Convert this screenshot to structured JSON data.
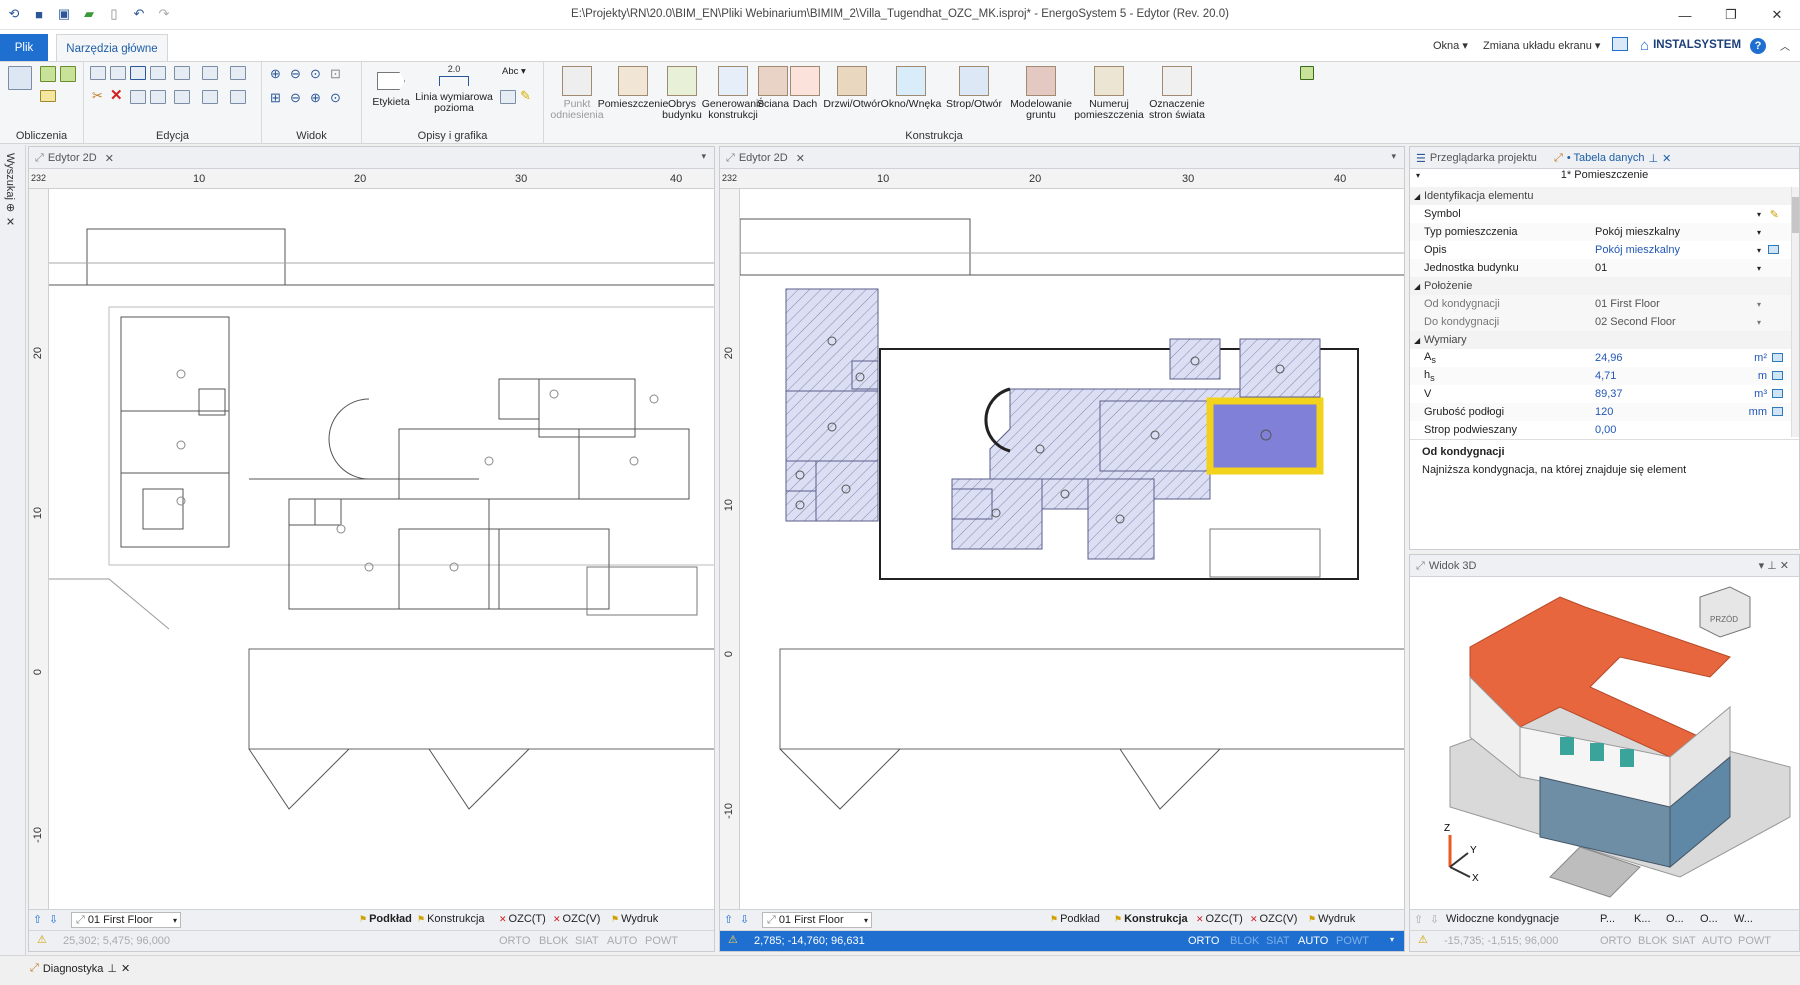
{
  "window": {
    "title": "E:\\Projekty\\RN\\20.0\\BIM_EN\\Pliki Webinarium\\BIMIM_2\\Villa_Tugendhat_OZC_MK.isproj* - EnergoSystem 5 - Edytor (Rev. 20.0)"
  },
  "tabs": {
    "file": "Plik",
    "main": "Narzędzia główne"
  },
  "topright": {
    "windows": "Okna",
    "layout": "Zmiana układu ekranu",
    "brand": "INSTALSYSTEM",
    "help": "?"
  },
  "ribbon": {
    "groups": {
      "calc": "Obliczenia",
      "edit": "Edycja",
      "view": "Widok",
      "desc": "Opisy i grafika",
      "constr": "Konstrukcja"
    },
    "desc_buttons": {
      "label": "Etykieta",
      "dimline": "Linia wymiarowa\npozioma",
      "dim_value": "2.0",
      "abc": "Abc"
    },
    "constr_buttons": [
      {
        "label": "Punkt\nodniesienia",
        "icon": "reference-point-icon",
        "disabled": true
      },
      {
        "label": "Pomieszczenie",
        "icon": "room-icon",
        "disabled": false
      },
      {
        "label": "Obrys\nbudynku",
        "icon": "building-outline-icon",
        "disabled": false
      },
      {
        "label": "Generowanie\nkonstrukcji",
        "icon": "generate-construction-icon",
        "disabled": false
      },
      {
        "label": "Ściana",
        "icon": "wall-icon",
        "disabled": false
      },
      {
        "label": "Dach",
        "icon": "roof-icon",
        "disabled": false
      },
      {
        "label": "Drzwi/Otwór",
        "icon": "door-icon",
        "disabled": false
      },
      {
        "label": "Okno/Wnęka",
        "icon": "window-icon",
        "disabled": false
      },
      {
        "label": "Strop/Otwór",
        "icon": "ceiling-icon",
        "disabled": false
      },
      {
        "label": "Modelowanie\ngruntu",
        "icon": "ground-modeling-icon",
        "disabled": false
      },
      {
        "label": "Numeruj\npomieszczenia",
        "icon": "number-rooms-icon",
        "disabled": false
      },
      {
        "label": "Oznaczenie\nstron świata",
        "icon": "compass-icon",
        "disabled": false
      }
    ]
  },
  "leftstrip": {
    "label": "Wyszukaj"
  },
  "editor_left": {
    "tab": "Edytor 2D",
    "ruler_corner": "232",
    "h_ticks": [
      "10",
      "20",
      "30",
      "40"
    ],
    "v_ticks": [
      "20",
      "10",
      "0",
      "-10"
    ],
    "floor": "01 First Floor",
    "bottom_tabs": [
      "Podkład",
      "Konstrukcja",
      "OZC(T)",
      "OZC(V)",
      "Wydruk"
    ],
    "status": [
      "25,302; 5,475; 96,000",
      "ORTO",
      "BLOK",
      "SIAT",
      "AUTO",
      "POWT"
    ]
  },
  "editor_right": {
    "tab": "Edytor 2D",
    "ruler_corner": "232",
    "h_ticks": [
      "10",
      "20",
      "30",
      "40"
    ],
    "v_ticks": [
      "20",
      "10",
      "0",
      "-10"
    ],
    "floor": "01 First Floor",
    "bottom_tabs": [
      "Podkład",
      "Konstrukcja",
      "OZC(T)",
      "OZC(V)",
      "Wydruk"
    ],
    "status": [
      "2,785; -14,760; 96,631",
      "ORTO",
      "BLOK",
      "SIAT",
      "AUTO",
      "POWT"
    ]
  },
  "datatable": {
    "tab_browser": "Przeglądarka projektu",
    "tab_table": "• Tabela danych",
    "title": "1* Pomieszczenie",
    "sections": {
      "ident": "Identyfikacja elementu",
      "position": "Położenie",
      "dims": "Wymiary"
    },
    "rows": {
      "symbol": {
        "k": "Symbol",
        "v": ""
      },
      "type": {
        "k": "Typ pomieszczenia",
        "v": "Pokój mieszkalny"
      },
      "desc": {
        "k": "Opis",
        "v": "Pokój mieszkalny"
      },
      "unit": {
        "k": "Jednostka budynku",
        "v": "01"
      },
      "from": {
        "k": "Od kondygnacji",
        "v": "01 First Floor"
      },
      "to": {
        "k": "Do kondygnacji",
        "v": "02 Second Floor"
      },
      "as": {
        "k": "A",
        "sub": "s",
        "v": "24,96",
        "u": "m²"
      },
      "hs": {
        "k": "h",
        "sub": "s",
        "v": "4,71",
        "u": "m"
      },
      "vol": {
        "k": "V",
        "v": "89,37",
        "u": "m³"
      },
      "floor": {
        "k": "Grubość podłogi",
        "v": "120",
        "u": "mm"
      },
      "ceil": {
        "k": "Strop podwieszany",
        "v": "0,00"
      }
    },
    "help_title": "Od kondygnacji",
    "help_text": "Najniższa kondygnacja, na której znajduje się element"
  },
  "view3d": {
    "tab": "Widok 3D",
    "cube_label": "PRZÓD",
    "axes": {
      "z": "Z",
      "y": "Y",
      "x": "X"
    },
    "bottom": [
      "Widoczne kondygnacje",
      "P...",
      "K...",
      "O...",
      "O...",
      "W..."
    ],
    "status": [
      "-15,735; -1,515; 96,000",
      "ORTO",
      "BLOK",
      "SIAT",
      "AUTO",
      "POWT"
    ]
  },
  "diagnostics": {
    "label": "Diagnostyka"
  },
  "colors": {
    "accent": "#1e6fd0",
    "roof": "#e8663d",
    "selection": "#f2d21b",
    "room_fill": "#dcdff3"
  }
}
